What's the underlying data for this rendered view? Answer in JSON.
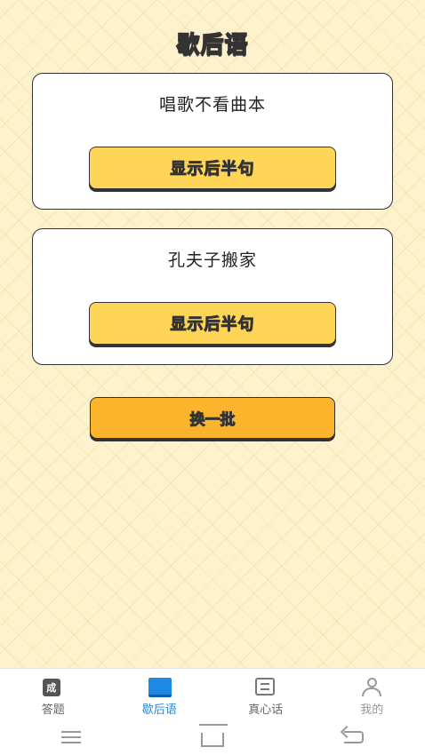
{
  "header": {
    "title": "歇后语"
  },
  "riddles": [
    {
      "text": "唱歌不看曲本",
      "button_label": "显示后半句"
    },
    {
      "text": "孔夫子搬家",
      "button_label": "显示后半句"
    }
  ],
  "swap_button": {
    "label": "换一批"
  },
  "tabbar": {
    "items": [
      {
        "label": "答题",
        "icon": "cheng-icon",
        "icon_text": "成",
        "active": false
      },
      {
        "label": "歇后语",
        "icon": "book-icon",
        "active": true
      },
      {
        "label": "真心话",
        "icon": "document-icon",
        "active": false
      },
      {
        "label": "我的",
        "icon": "user-icon",
        "active": false
      }
    ]
  },
  "colors": {
    "background": "#fdf2cc",
    "button_yellow": "#fed556",
    "button_orange": "#fdb42d",
    "active_tab": "#1e88e5"
  }
}
